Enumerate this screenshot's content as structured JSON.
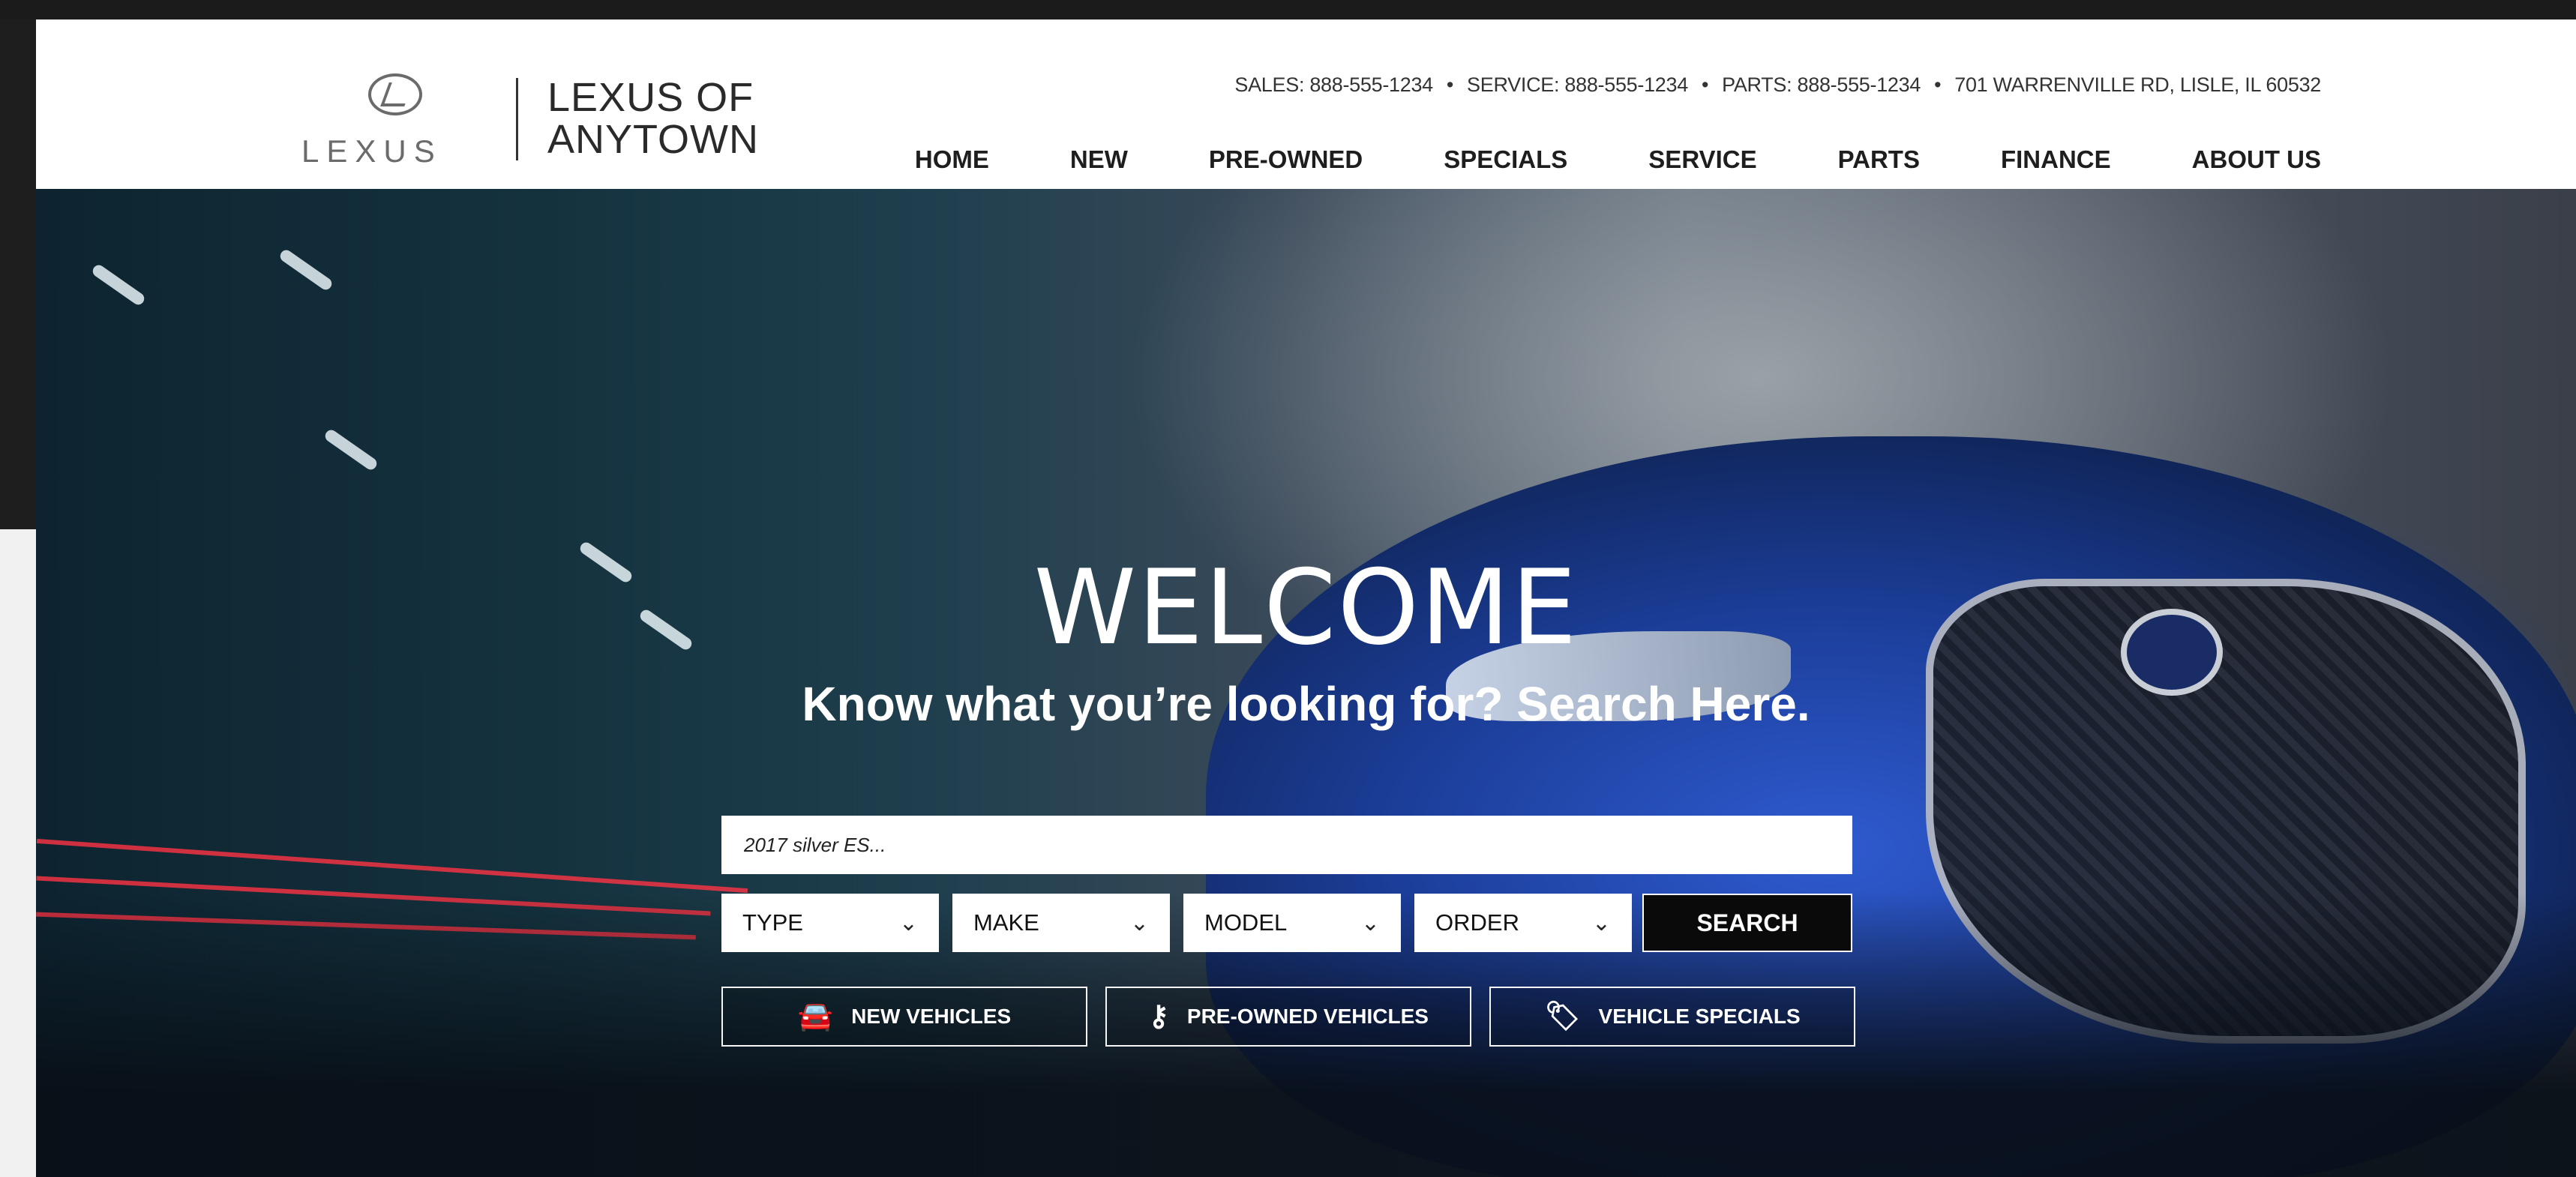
{
  "header": {
    "dealer_name_line1": "LEXUS OF",
    "dealer_name_line2": "ANYTOWN",
    "logo_word": "LEXUS",
    "contact": {
      "sales": "SALES: 888-555-1234",
      "service": "SERVICE: 888-555-1234",
      "parts": "PARTS: 888-555-1234",
      "address": "701 WARRENVILLE RD, LISLE, IL 60532",
      "separator": "•"
    },
    "nav": [
      {
        "label": "HOME"
      },
      {
        "label": "NEW"
      },
      {
        "label": "PRE-OWNED"
      },
      {
        "label": "SPECIALS"
      },
      {
        "label": "SERVICE"
      },
      {
        "label": "PARTS"
      },
      {
        "label": "FINANCE"
      },
      {
        "label": "ABOUT US"
      }
    ]
  },
  "hero": {
    "title": "WELCOME",
    "subtitle": "Know what you’re looking for? Search Here.",
    "search": {
      "placeholder": "2017 silver ES...",
      "selects": [
        "TYPE",
        "MAKE",
        "MODEL",
        "ORDER"
      ],
      "button": "SEARCH"
    },
    "quick_links": [
      {
        "label": "NEW VEHICLES",
        "icon": "car-front-icon"
      },
      {
        "label": "PRE-OWNED VEHICLES",
        "icon": "key-icon"
      },
      {
        "label": "VEHICLE SPECIALS",
        "icon": "tag-icon"
      }
    ]
  },
  "colors": {
    "header_bg": "#ffffff",
    "nav_text": "#1e1e1e",
    "search_button_bg": "#0a0a0a",
    "hero_text": "#ffffff"
  }
}
